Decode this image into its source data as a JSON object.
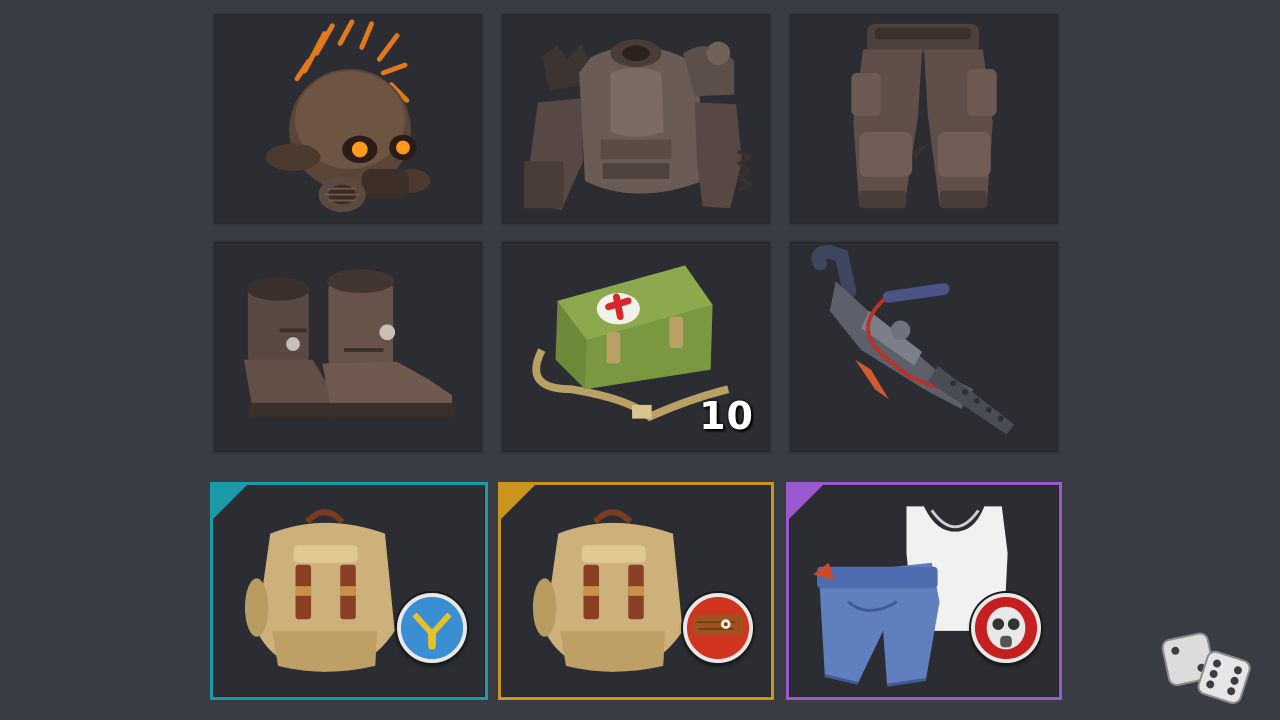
{
  "inventory": {
    "slots": [
      {
        "item": "skull-helmet",
        "rarity": "none"
      },
      {
        "item": "armor-vest",
        "rarity": "none"
      },
      {
        "item": "armor-pants",
        "rarity": "none"
      },
      {
        "item": "boots",
        "rarity": "none"
      },
      {
        "item": "medkit-bag",
        "rarity": "none",
        "quantity": "10"
      },
      {
        "item": "flamethrower",
        "rarity": "none"
      },
      {
        "item": "backpack",
        "rarity": "teal",
        "badge": "zipper-icon"
      },
      {
        "item": "backpack",
        "rarity": "gold",
        "badge": "wood-plank-icon"
      },
      {
        "item": "clothing-set",
        "rarity": "purple",
        "badge": "gas-mask-icon"
      }
    ]
  },
  "colors": {
    "background": "#393c42",
    "slot": "#2b2d32",
    "rarity_teal": "#1b9aa8",
    "rarity_gold": "#c9951c",
    "rarity_purple": "#9b59d0"
  },
  "controls": {
    "randomize_icon": "dice-icon"
  }
}
